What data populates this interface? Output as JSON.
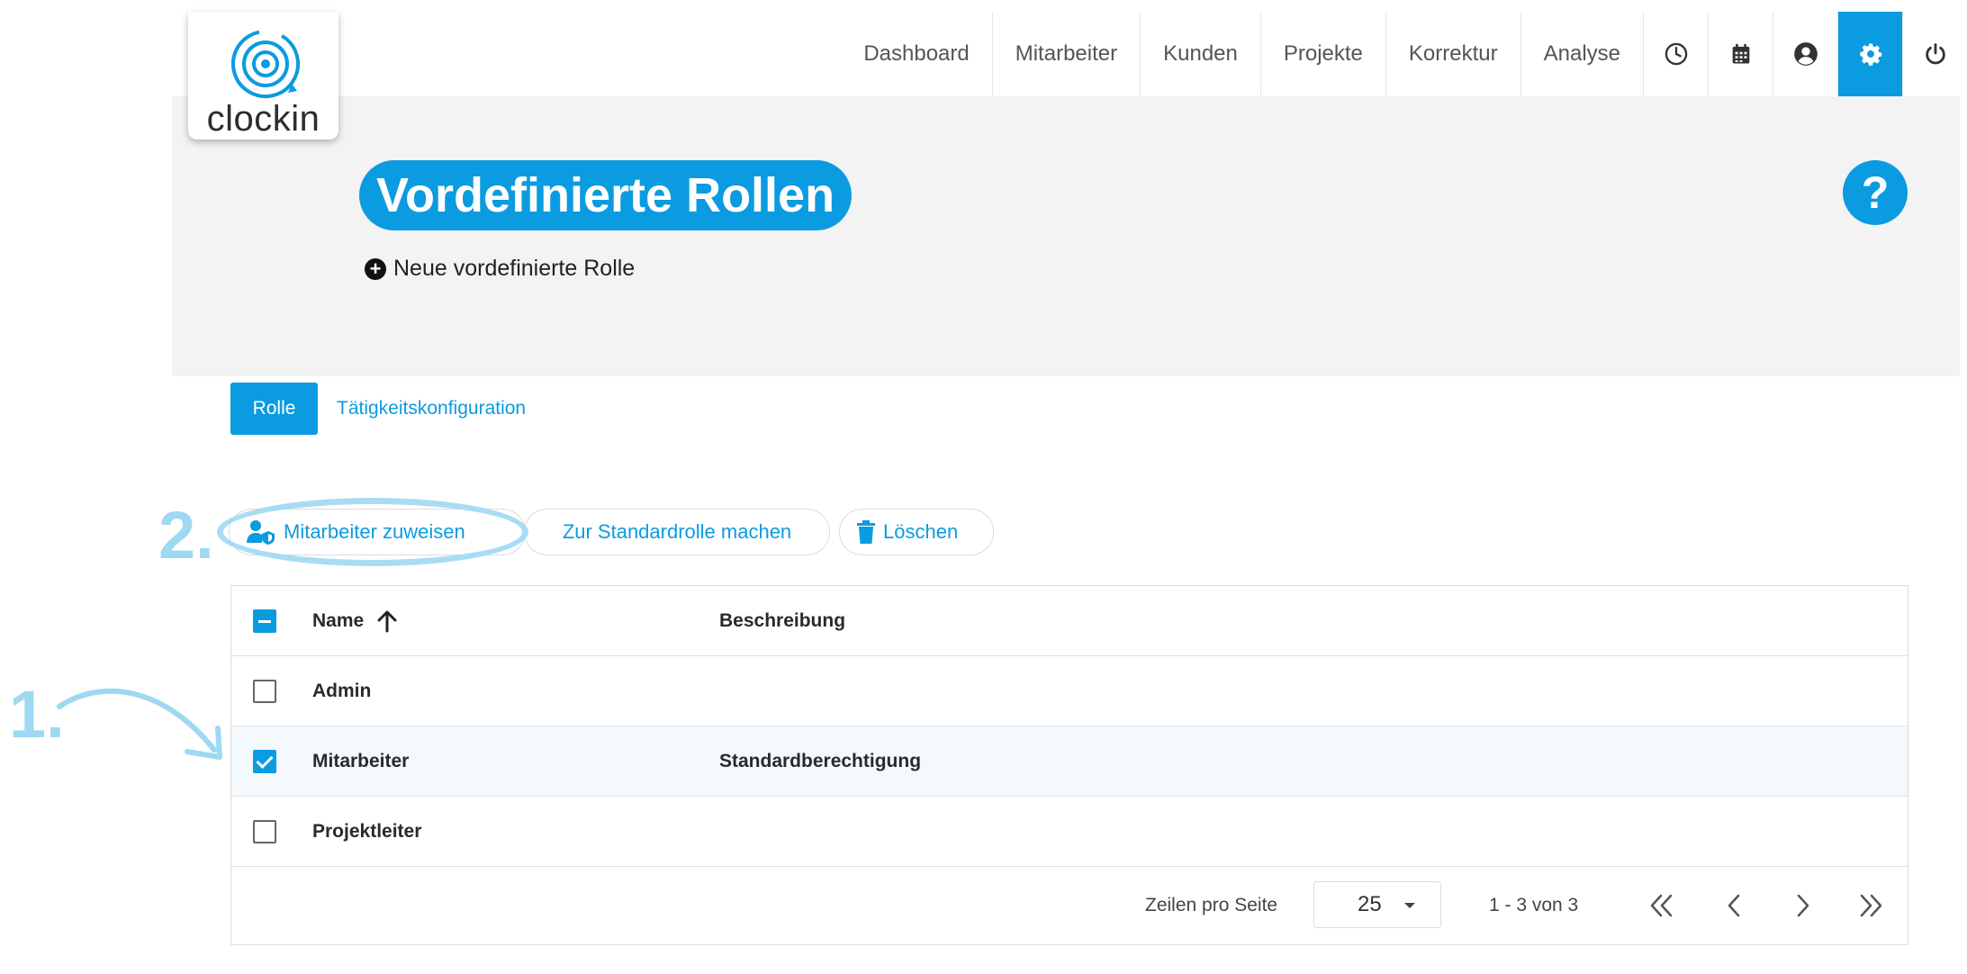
{
  "brand": {
    "name": "clockin",
    "accent": "#0b9be0",
    "annotation_color": "#9ed8f2"
  },
  "nav": {
    "links": [
      "Dashboard",
      "Mitarbeiter",
      "Kunden",
      "Projekte",
      "Korrektur",
      "Analyse"
    ],
    "icons": [
      "clock-icon",
      "calendar-icon",
      "user-circle-icon",
      "gear-icon",
      "power-icon"
    ],
    "active_icon": "gear-icon"
  },
  "header": {
    "title": "Vordefinierte Rollen",
    "new_role": "Neue vordefinierte Rolle",
    "help": "?"
  },
  "tabs": {
    "role": "Rolle",
    "activity_config": "Tätigkeitskonfiguration",
    "active": "Rolle"
  },
  "actions": {
    "assign": "Mitarbeiter zuweisen",
    "make_default": "Zur Standardrolle machen",
    "delete": "Löschen"
  },
  "annotations": {
    "step1": "1.",
    "step2": "2."
  },
  "table": {
    "columns": {
      "name": "Name",
      "description": "Beschreibung"
    },
    "header_checkbox": "indeterminate",
    "rows": [
      {
        "name": "Admin",
        "description": "",
        "checked": false
      },
      {
        "name": "Mitarbeiter",
        "description": "Standardberechtigung",
        "checked": true
      },
      {
        "name": "Projektleiter",
        "description": "",
        "checked": false
      }
    ]
  },
  "pagination": {
    "rows_per_page_label": "Zeilen pro Seite",
    "rows_per_page": "25",
    "range": "1 - 3 von 3"
  }
}
